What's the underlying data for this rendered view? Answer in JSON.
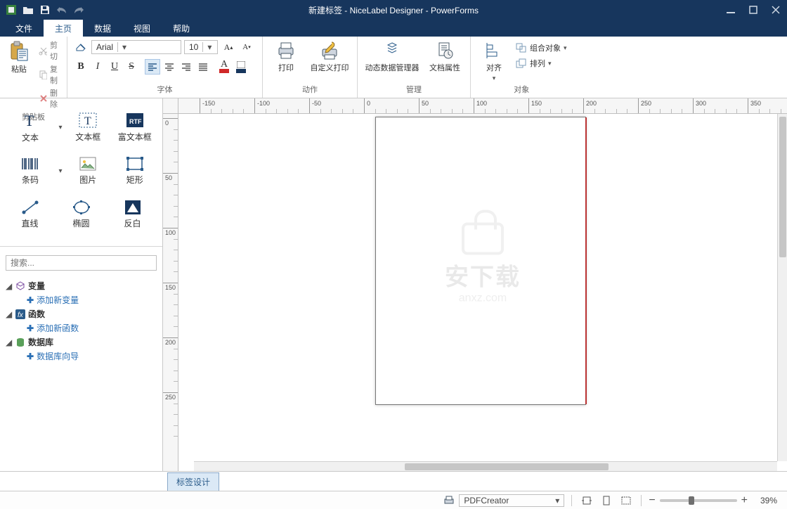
{
  "window": {
    "title": "新建标签 - NiceLabel Designer - PowerForms"
  },
  "menu": {
    "items": [
      "文件",
      "主页",
      "数据",
      "视图",
      "帮助"
    ],
    "active_index": 1
  },
  "ribbon": {
    "clipboard": {
      "paste": "粘贴",
      "cut": "剪切",
      "copy": "复制",
      "delete": "删除",
      "group_label": "剪贴板"
    },
    "font": {
      "name": "Arial",
      "size": "10",
      "group_label": "字体"
    },
    "action": {
      "print": "打印",
      "custom_print": "自定义打印",
      "group_label": "动作"
    },
    "manage": {
      "data_mgr": "动态数据管理器",
      "doc_props": "文档属性",
      "group_label": "管理"
    },
    "object": {
      "align": "对齐",
      "group": "组合对象",
      "arrange": "排列",
      "group_label": "对象"
    }
  },
  "toolbox": {
    "items": [
      {
        "label": "文本"
      },
      {
        "label": "文本框"
      },
      {
        "label": "富文本框"
      },
      {
        "label": "条码"
      },
      {
        "label": "图片"
      },
      {
        "label": "矩形"
      },
      {
        "label": "直线"
      },
      {
        "label": "椭圆"
      },
      {
        "label": "反白"
      }
    ],
    "search_placeholder": "搜索...",
    "tree": {
      "variables": {
        "label": "变量",
        "add": "添加新变量"
      },
      "functions": {
        "label": "函数",
        "add": "添加新函数"
      },
      "databases": {
        "label": "数据库",
        "add": "数据库向导"
      }
    }
  },
  "ruler": {
    "h_ticks": [
      "-150",
      "-100",
      "-50",
      "0",
      "50",
      "100",
      "150",
      "200",
      "250",
      "300",
      "350"
    ],
    "v_ticks": [
      "0",
      "50",
      "100",
      "150",
      "200",
      "250"
    ]
  },
  "watermark": {
    "big": "安下载",
    "small": "anxz.com"
  },
  "tabs": {
    "design": "标签设计"
  },
  "status": {
    "printer": "PDFCreator",
    "zoom": "39%"
  }
}
